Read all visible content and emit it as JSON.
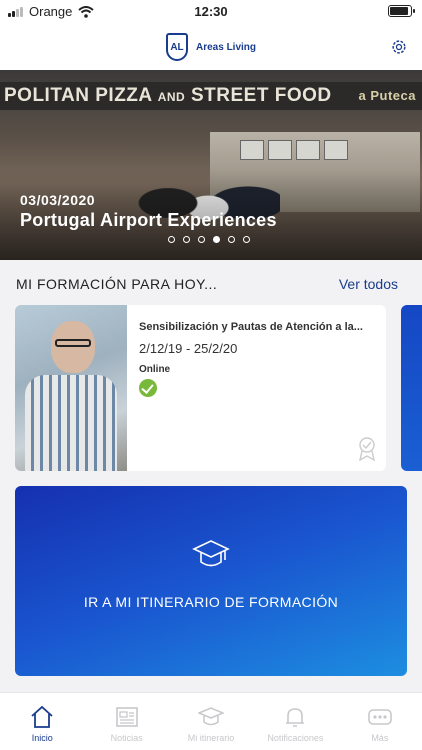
{
  "status_bar": {
    "carrier": "Orange",
    "time": "12:30"
  },
  "header": {
    "logo_mark": "AL",
    "logo_text": "Areas Living",
    "settings_icon": "gear-icon"
  },
  "hero": {
    "sign_text": "POLITAN PIZZA",
    "sign_and": "AND",
    "sign_text_2": "STREET FOOD",
    "sign_right": "a Puteca",
    "date": "03/03/2020",
    "title": "Portugal Airport Experiences",
    "slide_count": 6,
    "active_slide": 4
  },
  "formation": {
    "section_title": "MI FORMACIÓN PARA HOY...",
    "see_all": "Ver todos",
    "course": {
      "title": "Sensibilización y Pautas de Atención a la...",
      "dates": "2/12/19 - 25/2/20",
      "mode": "Online",
      "status_icon": "check-icon",
      "badge_icon": "badge-icon"
    }
  },
  "itinerary": {
    "label": "IR A MI ITINERARIO DE FORMACIÓN",
    "icon": "graduation-cap-icon"
  },
  "tabs": [
    {
      "label": "Inicio",
      "icon": "home-icon",
      "active": true
    },
    {
      "label": "Noticias",
      "icon": "newspaper-icon",
      "active": false
    },
    {
      "label": "Mi itinerario",
      "icon": "graduation-cap-icon",
      "active": false
    },
    {
      "label": "Notificaciones",
      "icon": "bell-icon",
      "active": false
    },
    {
      "label": "Más",
      "icon": "more-icon",
      "active": false
    }
  ],
  "colors": {
    "brand": "#1a3c8c",
    "accent_blue": "#1a57d0",
    "success": "#78b83a",
    "inactive": "#c8c8cc"
  }
}
